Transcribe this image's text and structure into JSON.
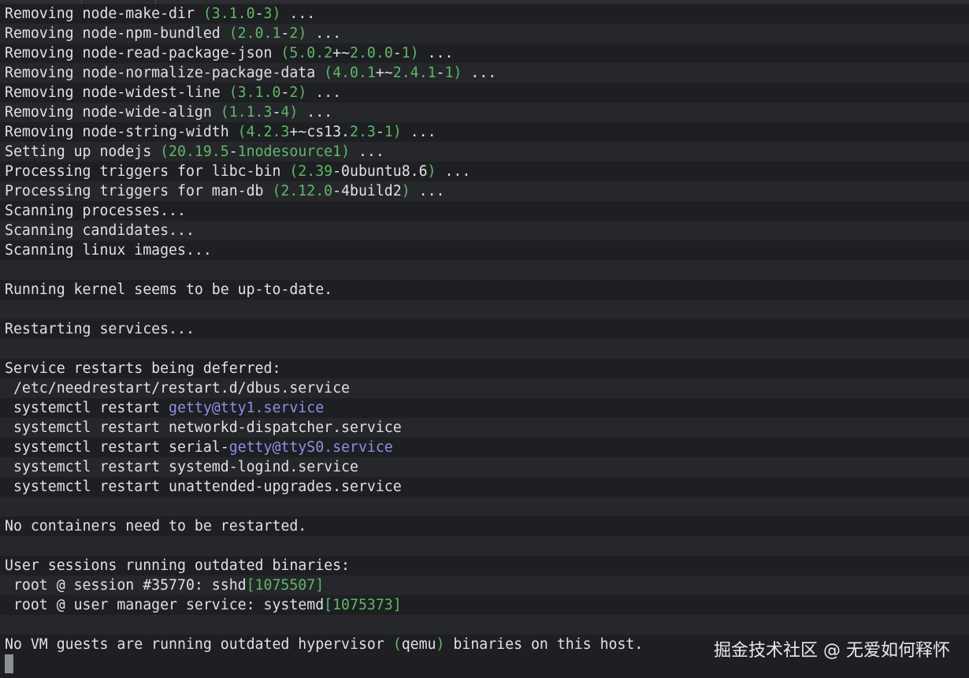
{
  "colors": {
    "background": "#1e1f22",
    "alt_row": "#25272b",
    "text": "#dfe1e5",
    "number": "#5fb865",
    "service_link": "#8f8fe6",
    "cursor": "#8c8f94"
  },
  "lines": [
    [
      {
        "t": "Removing node-make-dir "
      },
      {
        "t": "(3.1.0",
        "c": "g"
      },
      {
        "t": "-"
      },
      {
        "t": "3",
        "c": "g"
      },
      {
        "t": ")",
        "c": "g"
      },
      {
        "t": " ..."
      }
    ],
    [
      {
        "t": "Removing node-npm-bundled "
      },
      {
        "t": "(2.0.1",
        "c": "g"
      },
      {
        "t": "-"
      },
      {
        "t": "2",
        "c": "g"
      },
      {
        "t": ")",
        "c": "g"
      },
      {
        "t": " ..."
      }
    ],
    [
      {
        "t": "Removing node-read-package-json "
      },
      {
        "t": "(5.0.2",
        "c": "g"
      },
      {
        "t": "+~"
      },
      {
        "t": "2.0.0",
        "c": "g"
      },
      {
        "t": "-"
      },
      {
        "t": "1",
        "c": "g"
      },
      {
        "t": ")",
        "c": "g"
      },
      {
        "t": " ..."
      }
    ],
    [
      {
        "t": "Removing node-normalize-package-data "
      },
      {
        "t": "(4.0.1",
        "c": "g"
      },
      {
        "t": "+~"
      },
      {
        "t": "2.4.1",
        "c": "g"
      },
      {
        "t": "-"
      },
      {
        "t": "1",
        "c": "g"
      },
      {
        "t": ")",
        "c": "g"
      },
      {
        "t": " ..."
      }
    ],
    [
      {
        "t": "Removing node-widest-line "
      },
      {
        "t": "(3.1.0",
        "c": "g"
      },
      {
        "t": "-"
      },
      {
        "t": "2",
        "c": "g"
      },
      {
        "t": ")",
        "c": "g"
      },
      {
        "t": " ..."
      }
    ],
    [
      {
        "t": "Removing node-wide-align "
      },
      {
        "t": "(1.1.3",
        "c": "g"
      },
      {
        "t": "-"
      },
      {
        "t": "4",
        "c": "g"
      },
      {
        "t": ")",
        "c": "g"
      },
      {
        "t": " ..."
      }
    ],
    [
      {
        "t": "Removing node-string-width "
      },
      {
        "t": "(4.2.3",
        "c": "g"
      },
      {
        "t": "+~cs13."
      },
      {
        "t": "2.3",
        "c": "g"
      },
      {
        "t": "-"
      },
      {
        "t": "1",
        "c": "g"
      },
      {
        "t": ")",
        "c": "g"
      },
      {
        "t": " ..."
      }
    ],
    [
      {
        "t": "Setting up nodejs "
      },
      {
        "t": "(20.19.5",
        "c": "g"
      },
      {
        "t": "-"
      },
      {
        "t": "1nodesource1",
        "c": "g"
      },
      {
        "t": ")",
        "c": "g"
      },
      {
        "t": " ..."
      }
    ],
    [
      {
        "t": "Processing triggers for libc-bin "
      },
      {
        "t": "(2.39",
        "c": "g"
      },
      {
        "t": "-0ubuntu8.6"
      },
      {
        "t": ")",
        "c": "g"
      },
      {
        "t": " ..."
      }
    ],
    [
      {
        "t": "Processing triggers for man-db "
      },
      {
        "t": "(2.12.0",
        "c": "g"
      },
      {
        "t": "-4build2"
      },
      {
        "t": ")",
        "c": "g"
      },
      {
        "t": " ..."
      }
    ],
    [
      {
        "t": "Scanning processes..."
      }
    ],
    [
      {
        "t": "Scanning candidates..."
      }
    ],
    [
      {
        "t": "Scanning linux images..."
      }
    ],
    [],
    [
      {
        "t": "Running kernel seems to be up-to-date."
      }
    ],
    [],
    [
      {
        "t": "Restarting services..."
      }
    ],
    [],
    [
      {
        "t": "Service restarts being deferred:"
      }
    ],
    [
      {
        "t": " /etc/needrestart/restart.d/dbus.service"
      }
    ],
    [
      {
        "t": " systemctl restart "
      },
      {
        "t": "getty@tty1.service",
        "c": "p"
      }
    ],
    [
      {
        "t": " systemctl restart networkd-dispatcher.service"
      }
    ],
    [
      {
        "t": " systemctl restart serial-"
      },
      {
        "t": "getty@ttyS0.service",
        "c": "p"
      }
    ],
    [
      {
        "t": " systemctl restart systemd-logind.service"
      }
    ],
    [
      {
        "t": " systemctl restart unattended-upgrades.service"
      }
    ],
    [],
    [
      {
        "t": "No containers need to be restarted."
      }
    ],
    [],
    [
      {
        "t": "User sessions running outdated binaries:"
      }
    ],
    [
      {
        "t": " root @ session #35770: sshd"
      },
      {
        "t": "[1075507]",
        "c": "g"
      }
    ],
    [
      {
        "t": " root @ user manager service: systemd"
      },
      {
        "t": "[1075373]",
        "c": "g"
      }
    ],
    [],
    [
      {
        "t": "No VM guests are running outdated hypervisor "
      },
      {
        "t": "(",
        "c": "g"
      },
      {
        "t": "qemu"
      },
      {
        "t": ")",
        "c": "g"
      },
      {
        "t": " binaries on this host."
      }
    ]
  ],
  "watermark": "掘金技术社区 @ 无爱如何释怀"
}
